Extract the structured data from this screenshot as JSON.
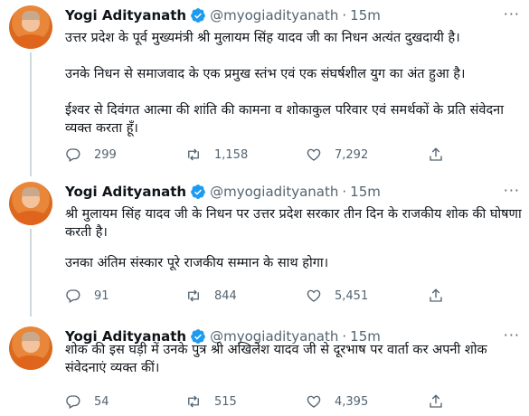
{
  "tweets": [
    {
      "name": "Yogi Adityanath",
      "handle": "@myogiadityanath",
      "time": "15m",
      "lines": [
        "उत्तर प्रदेश के पूर्व मुख्यमंत्री श्री मुलायम सिंह यादव जी का निधन अत्यंत दुखदायी है।",
        "",
        "उनके निधन से समाजवाद के एक प्रमुख स्तंभ एवं एक संघर्षशील युग का अंत हुआ है।",
        "",
        "ईश्वर से दिवंगत आत्मा की शांति की कामना व शोकाकुल परिवार एवं समर्थकों के प्रति संवेदना व्यक्त करता हूँ।"
      ],
      "replies": "299",
      "retweets": "1,158",
      "likes": "7,292"
    },
    {
      "name": "Yogi Adityanath",
      "handle": "@myogiadityanath",
      "time": "15m",
      "lines": [
        "श्री मुलायम सिंह यादव जी के निधन पर उत्तर प्रदेश सरकार तीन दिन के राजकीय शोक की घोषणा करती है।",
        "",
        "उनका अंतिम संस्कार पूरे राजकीय सम्मान के साथ होगा।"
      ],
      "replies": "91",
      "retweets": "844",
      "likes": "5,451"
    },
    {
      "name": "Yogi Adityanath",
      "handle": "@myogiadityanath",
      "time": "15m",
      "lines": [
        "शोक की इस घड़ी में उनके पुत्र श्री अखिलेश यादव जी से दूरभाष पर वार्ता कर अपनी शोक संवेदनाएं व्यक्त कीं।"
      ],
      "replies": "54",
      "retweets": "515",
      "likes": "4,395"
    }
  ],
  "icons": {
    "verified": "verified-badge-icon",
    "reply": "reply-icon",
    "retweet": "retweet-icon",
    "like": "heart-icon",
    "share": "share-icon",
    "more": "more-options-icon"
  },
  "colors": {
    "verified": "#1d9bf0",
    "muted": "#536471",
    "text": "#0f1419"
  }
}
